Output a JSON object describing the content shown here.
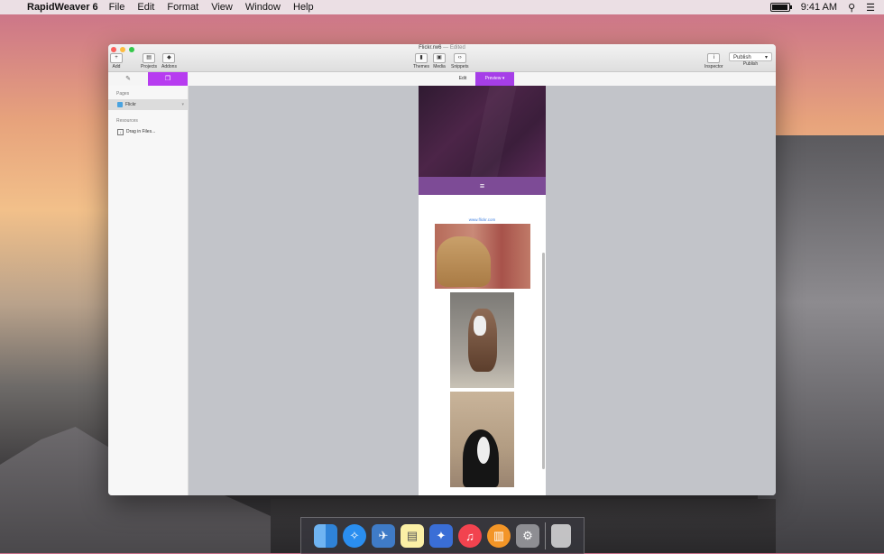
{
  "menubar": {
    "app_name": "RapidWeaver 6",
    "items": [
      "File",
      "Edit",
      "Format",
      "View",
      "Window",
      "Help"
    ],
    "clock": "9:41 AM"
  },
  "window": {
    "title": "Flickr.rw6",
    "title_status": "— Edited",
    "toolbar": {
      "add_label": "Add",
      "projects_label": "Projects",
      "addons_label": "Addons",
      "themes_label": "Themes",
      "media_label": "Media",
      "snippets_label": "Snippets",
      "inspector_label": "Inspector",
      "publish_button": "Publish",
      "publish_label": "Publish"
    },
    "modes": {
      "edit": "Edit",
      "preview": "Preview"
    },
    "sidebar": {
      "pages_heading": "Pages",
      "pages": [
        {
          "label": "Flickr"
        }
      ],
      "resources_heading": "Resources",
      "resources_item": "Drag in Files..."
    },
    "preview": {
      "nav_icon": "≡",
      "flickr_link": "www.flickr.com"
    }
  },
  "dock": {
    "apps": [
      "finder-icon",
      "safari-icon",
      "mail-icon",
      "notes-icon",
      "rapidweaver-icon",
      "itunes-icon",
      "ibooks-icon",
      "system-preferences-icon",
      "trash-icon"
    ]
  },
  "colors": {
    "accent": "#b73cf0",
    "hero_nav": "#7d4b96"
  }
}
